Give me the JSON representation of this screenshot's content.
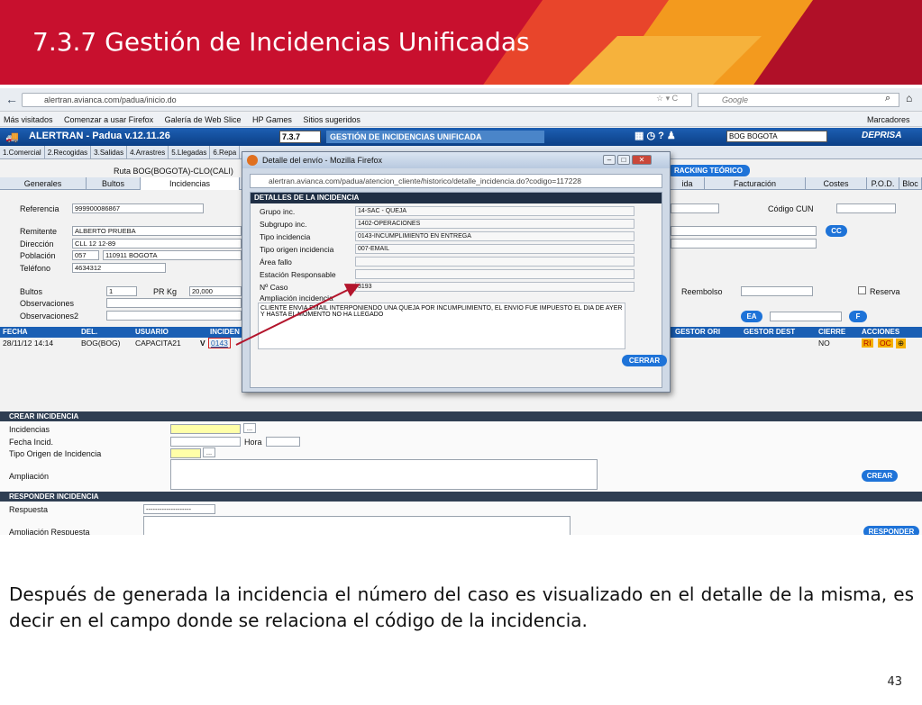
{
  "slide": {
    "title": "7.3.7 Gestión de Incidencias Unificadas",
    "caption": "Después de generada la incidencia el número del caso es visualizado en el detalle de la misma,  es decir en el campo donde se relaciona el código de la incidencia.",
    "page_number": "43",
    "accent_color": "#c8102e"
  },
  "browser": {
    "url": "alertran.avianca.com/padua/inicio.do",
    "search_placeholder": "Google",
    "bookmarks": [
      "Más visitados",
      "Comenzar a usar Firefox",
      "Galería de Web Slice",
      "HP Games",
      "Sitios sugeridos"
    ],
    "bookmarks_menu": "Marcadores"
  },
  "app": {
    "name": "ALERTRAN - Padua  v.12.11.26",
    "code": "7.3.7",
    "module": "GESTIÓN DE INCIDENCIAS UNIFICADA",
    "office": "BOG BOGOTA",
    "brand": "DEPRISA",
    "menu": [
      "1.Comercial",
      "2.Recogidas",
      "3.Salidas",
      "4.Arrastres",
      "5.Llegadas",
      "6.Repa"
    ],
    "ruta": "Ruta BOG(BOGOTA)-CLO(CALI)",
    "tracking_btn": "RACKING TEÓRICO",
    "tabs_left": [
      "Generales",
      "Bultos",
      "Incidencias"
    ],
    "tabs_right": [
      "ida",
      "Facturación",
      "Costes",
      "P.O.D.",
      "Bloc"
    ]
  },
  "form": {
    "referencia_label": "Referencia",
    "referencia": "999900086867",
    "codigo_cun_label": "Código CUN",
    "remitente_label": "Remitente",
    "remitente": "ALBERTO PRUEBA",
    "direccion_label": "Dirección",
    "direccion": "CLL 12 12-89",
    "poblacion_label": "Población",
    "poblacion_code": "057",
    "poblacion": "110911 BOGOTA",
    "telefono_label": "Teléfono",
    "telefono": "4634312",
    "cc_btn": "CC",
    "bultos_label": "Bultos",
    "bultos": "1",
    "prkg_label": "PR Kg",
    "prkg": "20,000",
    "reembolso_label": "Reembolso",
    "reserva_label": "Reserva",
    "observaciones_label": "Observaciones",
    "observaciones2_label": "Observaciones2",
    "ea_btn": "EA",
    "f_btn": "F"
  },
  "grid": {
    "headers": [
      "FECHA",
      "DEL.",
      "USUARIO",
      "INCIDEN",
      "GESTOR ORI",
      "GESTOR DEST",
      "CIERRE",
      "ACCIONES"
    ],
    "row": {
      "fecha": "28/11/12 14:14",
      "del": "BOG(BOG)",
      "usuario": "CAPACITA21",
      "v": "V",
      "incidencia": "0143",
      "cierre": "NO",
      "acciones": [
        "RI",
        "OC",
        "⊕"
      ]
    }
  },
  "crear": {
    "section": "CREAR INCIDENCIA",
    "incidencias_label": "Incidencias",
    "fecha_label": "Fecha Incid.",
    "hora_label": "Hora",
    "tipo_origen_label": "Tipo Origen de Incidencia",
    "ampliacion_label": "Ampliación",
    "crear_btn": "CREAR",
    "dots": "..."
  },
  "responder": {
    "section": "RESPONDER INCIDENCIA",
    "respuesta_label": "Respuesta",
    "respuesta_value": "--------------------",
    "ampliacion_label": "Ampliación Respuesta",
    "responder_btn": "RESPONDER"
  },
  "popup": {
    "title": "Detalle del envío - Mozilla Firefox",
    "url": "alertran.avianca.com/padua/atencion_cliente/historico/detalle_incidencia.do?codigo=117228",
    "header": "DETALLES DE LA INCIDENCIA",
    "fields": [
      {
        "label": "Grupo inc.",
        "value": "14-SAC - QUEJA"
      },
      {
        "label": "Subgrupo inc.",
        "value": "1402-OPERACIONES"
      },
      {
        "label": "Tipo incidencia",
        "value": "0143-INCUMPLIMIENTO EN ENTREGA"
      },
      {
        "label": "Tipo origen incidencia",
        "value": "007-EMAIL"
      },
      {
        "label": "Área fallo",
        "value": ""
      },
      {
        "label": "Estación Responsable",
        "value": ""
      },
      {
        "label": "Nº Caso",
        "value": "3193"
      }
    ],
    "ampliacion_label": "Ampliación incidencia",
    "ampliacion": "CLIENTE ENVIA EMAIL INTERPONIENDO UNA QUEJA POR INCUMPLIMIENTO, EL ENVIO FUE IMPUESTO EL DIA DE AYER Y HASTA EL MOMENTO NO HA LLEGADO",
    "cerrar_btn": "CERRAR"
  }
}
